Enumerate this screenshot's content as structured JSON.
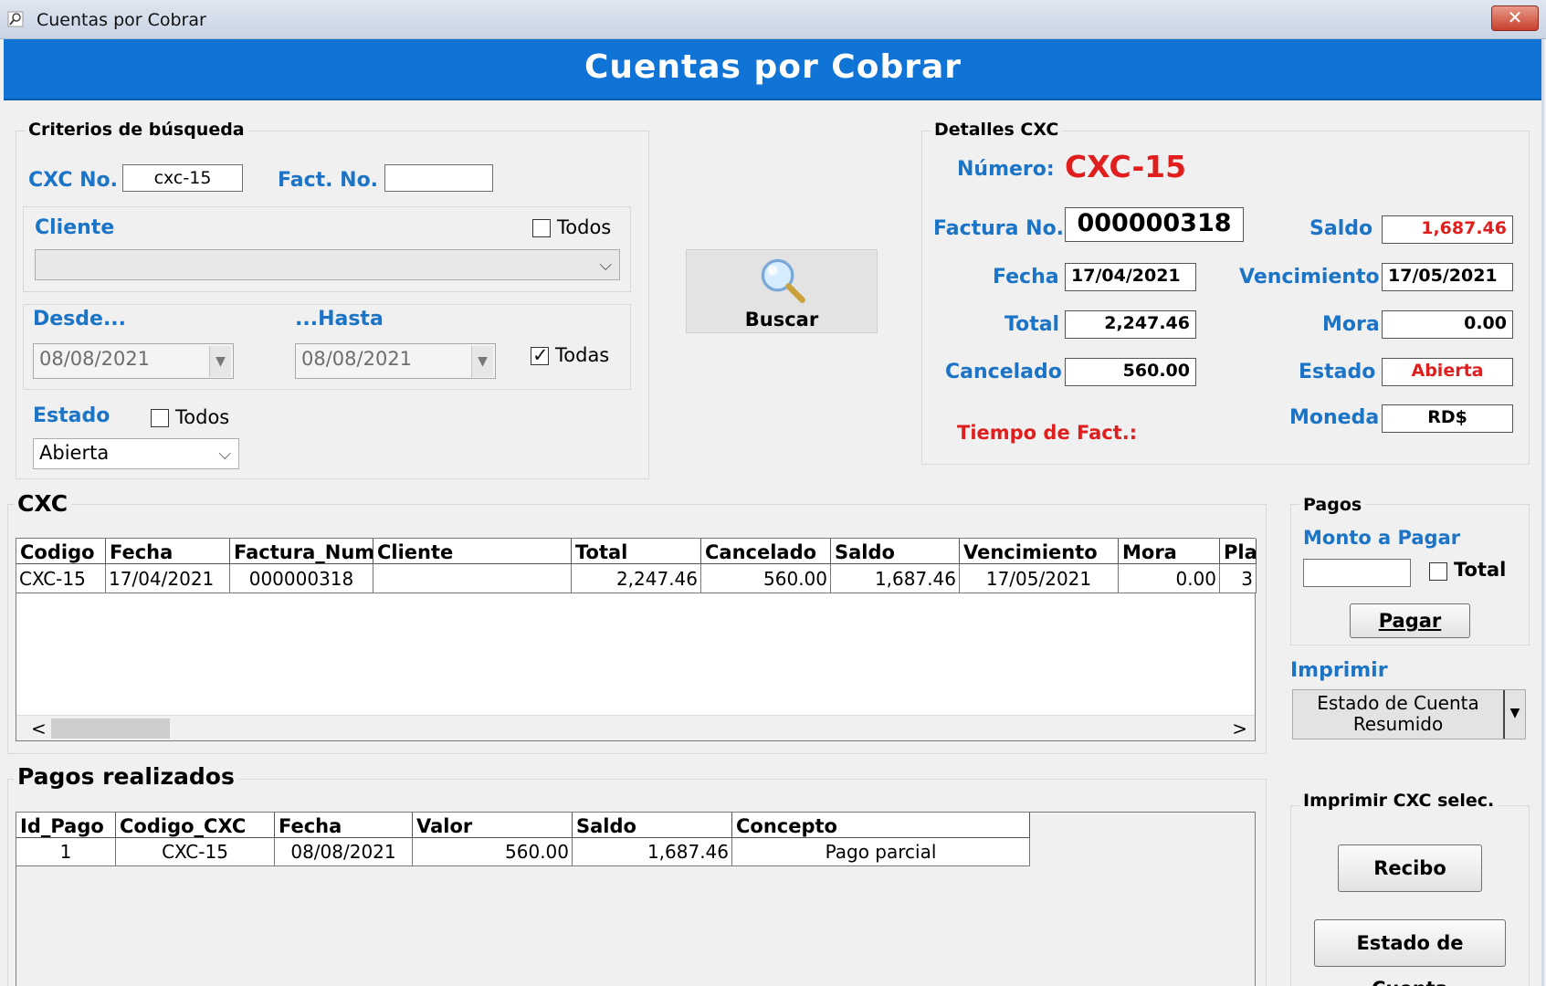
{
  "window": {
    "title": "Cuentas por Cobrar",
    "close_label": "✕"
  },
  "banner": {
    "title": "Cuentas por Cobrar"
  },
  "search": {
    "legend": "Criterios de búsqueda",
    "cxc_label": "CXC No.",
    "cxc_value": "cxc-15",
    "fact_label": "Fact. No.",
    "fact_value": "",
    "cliente_label": "Cliente",
    "cliente_todos": "Todos",
    "cliente_value": "",
    "desde_label": "Desde...",
    "hasta_label": "...Hasta",
    "desde_value": "08/08/2021",
    "hasta_value": "08/08/2021",
    "todas_label": "Todas",
    "estado_label": "Estado",
    "estado_todos": "Todos",
    "estado_value": "Abierta"
  },
  "buscar_label": "Buscar",
  "details": {
    "legend": "Detalles CXC",
    "numero_label": "Número:",
    "numero_value": "CXC-15",
    "factura_label": "Factura No.",
    "factura_value": "000000318",
    "saldo_label": "Saldo",
    "saldo_value": "1,687.46",
    "fecha_label": "Fecha",
    "fecha_value": "17/04/2021",
    "venc_label": "Vencimiento",
    "venc_value": "17/05/2021",
    "total_label": "Total",
    "total_value": "2,247.46",
    "mora_label": "Mora",
    "mora_value": "0.00",
    "cancelado_label": "Cancelado",
    "cancelado_value": "560.00",
    "estado_label": "Estado",
    "estado_value": "Abierta",
    "tiempo_label": "Tiempo de Fact.:",
    "moneda_label": "Moneda",
    "moneda_value": "RD$"
  },
  "cxc_grid": {
    "title": "CXC",
    "headers": [
      "Codigo",
      "Fecha",
      "Factura_Num",
      "Cliente",
      "Total",
      "Cancelado",
      "Saldo",
      "Vencimiento",
      "Mora",
      "Pla"
    ],
    "rows": [
      [
        "CXC-15",
        "17/04/2021",
        "000000318",
        "",
        "2,247.46",
        "560.00",
        "1,687.46",
        "17/05/2021",
        "0.00",
        "3"
      ]
    ],
    "scroll_left": "<",
    "scroll_right": ">"
  },
  "pagos": {
    "legend": "Pagos",
    "monto_label": "Monto a Pagar",
    "monto_value": "",
    "total_label": "Total",
    "pagar_label": "Pagar"
  },
  "imprimir": {
    "label": "Imprimir",
    "option_line1": "Estado de Cuenta",
    "option_line2": "Resumido"
  },
  "pagos_grid": {
    "title": "Pagos realizados",
    "headers": [
      "Id_Pago",
      "Codigo_CXC",
      "Fecha",
      "Valor",
      "Saldo",
      "Concepto"
    ],
    "rows": [
      [
        "1",
        "CXC-15",
        "08/08/2021",
        "560.00",
        "1,687.46",
        "Pago parcial"
      ]
    ]
  },
  "imprimir_cxc": {
    "legend": "Imprimir CXC selec.",
    "recibo_label": "Recibo",
    "estado_cuenta_label": "Estado de Cuenta"
  },
  "colors": {
    "banner": "#0f74d6",
    "label_blue": "#1c74c7",
    "accent_red": "#e01e1e"
  }
}
